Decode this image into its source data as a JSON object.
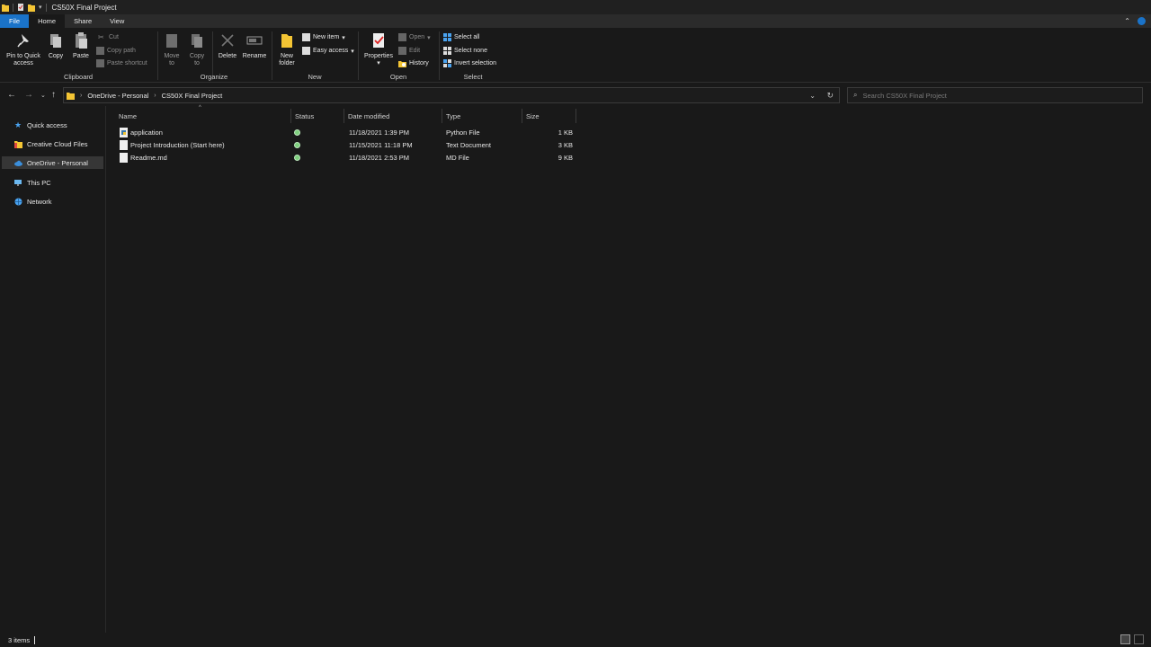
{
  "window": {
    "title": "CS50X Final Project"
  },
  "ribbon_tabs": [
    "File",
    "Home",
    "Share",
    "View"
  ],
  "clipboard": {
    "label": "Clipboard",
    "pin": "Pin to Quick access",
    "pin_l1": "Pin to Quick",
    "pin_l2": "access",
    "copy": "Copy",
    "paste": "Paste",
    "cut": "Cut",
    "copy_path": "Copy path",
    "paste_shortcut": "Paste shortcut"
  },
  "organize": {
    "label": "Organize",
    "move_l1": "Move",
    "move_l2": "to",
    "copy_l1": "Copy",
    "copy_l2": "to",
    "delete": "Delete",
    "rename": "Rename"
  },
  "new_group": {
    "label": "New",
    "new_folder_l1": "New",
    "new_folder_l2": "folder",
    "new_item": "New item",
    "easy_access": "Easy access"
  },
  "open_group": {
    "label": "Open",
    "properties": "Properties",
    "open": "Open",
    "edit": "Edit",
    "history": "History"
  },
  "select_group": {
    "label": "Select",
    "select_all": "Select all",
    "select_none": "Select none",
    "invert": "Invert selection"
  },
  "address": {
    "crumbs": [
      "OneDrive - Personal",
      "CS50X Final Project"
    ]
  },
  "search": {
    "placeholder": "Search CS50X Final Project"
  },
  "nav": {
    "items": [
      "Quick access",
      "Creative Cloud Files",
      "OneDrive - Personal",
      "This PC",
      "Network"
    ]
  },
  "columns": [
    "Name",
    "Status",
    "Date modified",
    "Type",
    "Size"
  ],
  "files": [
    {
      "name": "application",
      "date": "11/18/2021 1:39 PM",
      "type": "Python File",
      "size": "1 KB"
    },
    {
      "name": "Project Introduction (Start here)",
      "date": "11/15/2021 11:18 PM",
      "type": "Text Document",
      "size": "3 KB"
    },
    {
      "name": "Readme.md",
      "date": "11/18/2021 2:53 PM",
      "type": "MD File",
      "size": "9 KB"
    }
  ],
  "statusbar": {
    "items": "3 items"
  },
  "colors": {
    "file_tab": "#1a73c9",
    "folder": "#f4c534",
    "synced": "#7fd17f",
    "onedrive": "#3b8fdc"
  }
}
